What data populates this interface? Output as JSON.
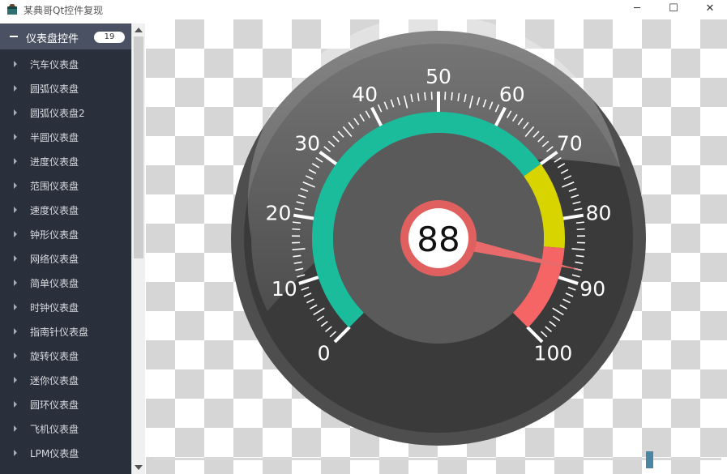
{
  "window": {
    "title": "某典哥Qt控件复现",
    "minimize_glyph": "─",
    "maximize_glyph": "☐",
    "close_glyph": "✕",
    "icon": "app-window-icon"
  },
  "sidebar": {
    "group_title": "仪表盘控件",
    "group_count": "19",
    "items": [
      {
        "label": "汽车仪表盘"
      },
      {
        "label": "圆弧仪表盘"
      },
      {
        "label": "圆弧仪表盘2"
      },
      {
        "label": "半圆仪表盘"
      },
      {
        "label": "进度仪表盘"
      },
      {
        "label": "范围仪表盘"
      },
      {
        "label": "速度仪表盘"
      },
      {
        "label": "钟形仪表盘"
      },
      {
        "label": "网络仪表盘"
      },
      {
        "label": "简单仪表盘"
      },
      {
        "label": "时钟仪表盘"
      },
      {
        "label": "指南针仪表盘"
      },
      {
        "label": "旋转仪表盘"
      },
      {
        "label": "迷你仪表盘"
      },
      {
        "label": "圆环仪表盘"
      },
      {
        "label": "飞机仪表盘"
      },
      {
        "label": "LPM仪表盘"
      }
    ]
  },
  "gauge": {
    "value": 88,
    "value_text": "88",
    "min": 0,
    "max": 100,
    "scale_labels": [
      "0",
      "10",
      "20",
      "30",
      "40",
      "50",
      "60",
      "70",
      "80",
      "90",
      "100"
    ],
    "ranges": [
      {
        "from": 0,
        "to": 70,
        "color": "#1abc9c"
      },
      {
        "from": 70,
        "to": 85,
        "color": "#d8d400"
      },
      {
        "from": 85,
        "to": 100,
        "color": "#f56565"
      }
    ],
    "colors": {
      "outer_ring": "#4e4e4e",
      "dial_face": "#3a3a3a",
      "inner_circle": "#5a5a5a",
      "needle": "#e86a6a",
      "center_ring": "#e06060",
      "center_fill": "#ffffff",
      "text": "#ffffff"
    }
  },
  "slider": {
    "value_fraction": 0.88
  }
}
